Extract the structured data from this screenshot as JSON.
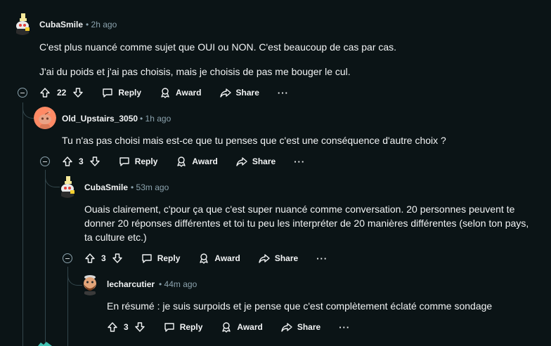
{
  "comments": [
    {
      "author": "CubaSmile",
      "time": "2h ago",
      "paragraphs": [
        "C'est plus nuancé comme sujet que OUI ou NON. C'est beaucoup de cas par cas.",
        "J'ai du poids et j'ai pas choisis, mais je choisis de pas me bouger le cul."
      ],
      "votes": "22",
      "avatar_icon": "snoo-banana-avatar-icon"
    },
    {
      "author": "Old_Upstairs_3050",
      "time": "1h ago",
      "paragraphs": [
        "Tu n'as pas choisi mais est-ce que tu penses que c'est une conséquence d'autre choix ?"
      ],
      "votes": "3",
      "avatar_icon": "default-orange-snoo-avatar-icon"
    },
    {
      "author": "CubaSmile",
      "time": "53m ago",
      "paragraphs": [
        "Ouais clairement, c'pour ça que c'est super nuancé comme conversation. 20 personnes peuvent te donner 20 réponses différentes et toi tu peu les interpréter de 20 manières différentes (selon ton pays, ta culture etc.)"
      ],
      "votes": "3",
      "avatar_icon": "snoo-banana-avatar-icon"
    },
    {
      "author": "lecharcutier",
      "time": "44m ago",
      "paragraphs": [
        "En résumé : je suis surpoids et je pense que c'est complètement éclaté comme sondage"
      ],
      "votes": "3",
      "avatar_icon": "bearded-snoo-avatar-icon"
    }
  ],
  "actions": {
    "reply": "Reply",
    "award": "Award",
    "share": "Share",
    "more": "···"
  },
  "colors": {
    "background": "#0b1416",
    "text": "#f2f4f5",
    "meta": "#8ba2ad",
    "thread_line": "#33464c"
  }
}
